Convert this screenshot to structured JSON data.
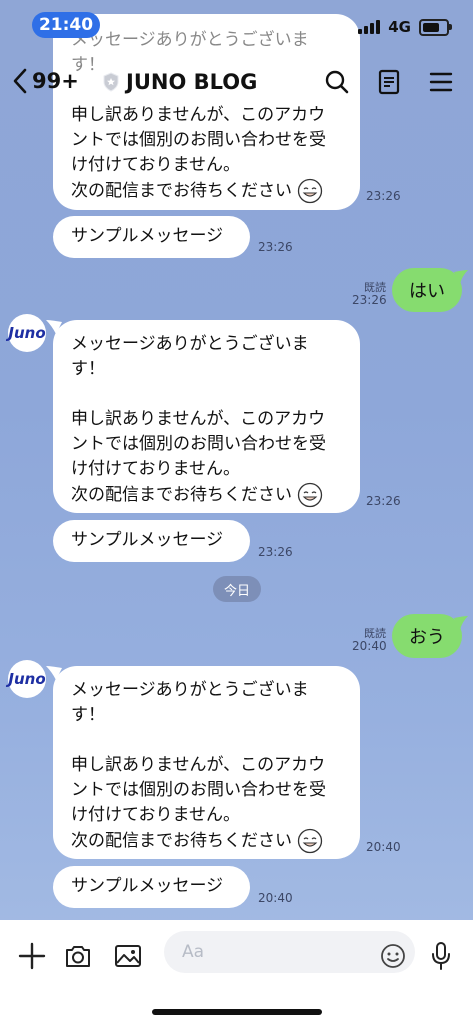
{
  "status": {
    "time": "21:40",
    "network": "4G"
  },
  "header": {
    "back_count": "99+",
    "title": "JUNO BLOG"
  },
  "avatar_text": "Juno",
  "messages": [
    {
      "line1": "メッセージありがとうございます！",
      "line2": "申し訳ありませんが、このアカウントでは個別のお問い合わせを受け付けておりません。",
      "line3": "次の配信までお待ちください",
      "time": "23:26"
    },
    {
      "text": "サンプルメッセージ",
      "time": "23:26"
    },
    {
      "text": "はい",
      "read": "既読",
      "time": "23:26"
    },
    {
      "line1a": "メッセージありがとうございま",
      "line1b": "す！",
      "line2a": "申し訳ありませんが、このアカウ",
      "line2b": "ントでは個別のお問い合わせを受",
      "line2c": "け付けておりません。",
      "line3": "次の配信までお待ちください",
      "time": "23:26"
    },
    {
      "text": "サンプルメッセージ",
      "time": "23:26"
    },
    {
      "date": "今日"
    },
    {
      "text": "おう",
      "read": "既読",
      "time": "20:40"
    },
    {
      "line1a": "メッセージありがとうございま",
      "line1b": "す！",
      "line2a": "申し訳ありませんが、このアカウ",
      "line2b": "ントでは個別のお問い合わせを受",
      "line2c": "け付けておりません。",
      "line3": "次の配信までお待ちください",
      "time": "20:40"
    },
    {
      "text": "サンプルメッセージ",
      "time": "20:40"
    }
  ],
  "top_partial": {
    "line1": "メッセージありがとうございます！",
    "line2": "申し訳ありませんが、このアカウ",
    "line3": "ントでは個別のお問い合わせを受",
    "line4": "け付けておりません。",
    "line5": "次の配信までお待ちください",
    "time": "23:26"
  },
  "input": {
    "placeholder": "Aa"
  },
  "colors": {
    "accent_pill": "#2F6FE7",
    "out_bubble": "#86DC6F",
    "background": "#8FA6D6"
  },
  "icons": [
    "plus-icon",
    "camera-icon",
    "image-icon",
    "emoji-icon",
    "mic-icon",
    "search-icon",
    "notes-icon",
    "menu-icon"
  ]
}
